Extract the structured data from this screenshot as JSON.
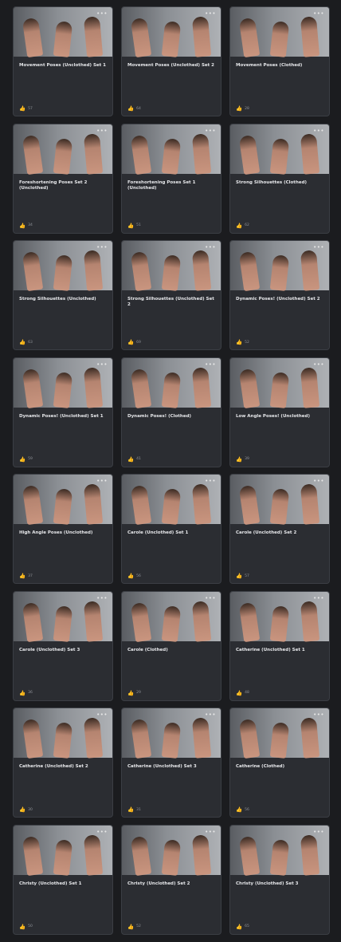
{
  "cards": [
    {
      "title": "Movement Poses (Unclothed) Set 1",
      "likes": "57"
    },
    {
      "title": "Movement Poses (Unclothed) Set 2",
      "likes": "64"
    },
    {
      "title": "Movement Poses (Clothed)",
      "likes": "28"
    },
    {
      "title": "Foreshortening Poses Set 2 (Unclothed)",
      "likes": "34"
    },
    {
      "title": "Foreshortening Poses Set 1 (Unclothed)",
      "likes": "51"
    },
    {
      "title": "Strong Silhouettes (Clothed)",
      "likes": "62"
    },
    {
      "title": "Strong Silhouettes (Unclothed)",
      "likes": "63"
    },
    {
      "title": "Strong Silhouettes (Unclothed) Set 2",
      "likes": "69"
    },
    {
      "title": "Dynamic Poses! (Unclothed) Set 2",
      "likes": "52"
    },
    {
      "title": "Dynamic Poses! (Unclothed) Set 1",
      "likes": "59"
    },
    {
      "title": "Dynamic Poses! (Clothed)",
      "likes": "41"
    },
    {
      "title": "Low Angle Poses! (Unclothed)",
      "likes": "39"
    },
    {
      "title": "High Angle Poses (Unclothed)",
      "likes": "37"
    },
    {
      "title": "Carole (Unclothed) Set 1",
      "likes": "56"
    },
    {
      "title": "Carole (Unclothed) Set 2",
      "likes": "57"
    },
    {
      "title": "Carole (Unclothed) Set 3",
      "likes": "36"
    },
    {
      "title": "Carole (Clothed)",
      "likes": "29"
    },
    {
      "title": "Catherine (Unclothed) Set 1",
      "likes": "48"
    },
    {
      "title": "Catherine (Unclothed) Set 2",
      "likes": "30"
    },
    {
      "title": "Catherine (Unclothed) Set 3",
      "likes": "31"
    },
    {
      "title": "Catherine (Clothed)",
      "likes": "56"
    },
    {
      "title": "Christy (Unclothed) Set 1",
      "likes": "50"
    },
    {
      "title": "Christy (Unclothed) Set 2",
      "likes": "52"
    },
    {
      "title": "Christy (Unclothed) Set 3",
      "likes": "65"
    }
  ],
  "icons": {
    "more": "more-icon",
    "like": "thumbs-up-icon"
  }
}
